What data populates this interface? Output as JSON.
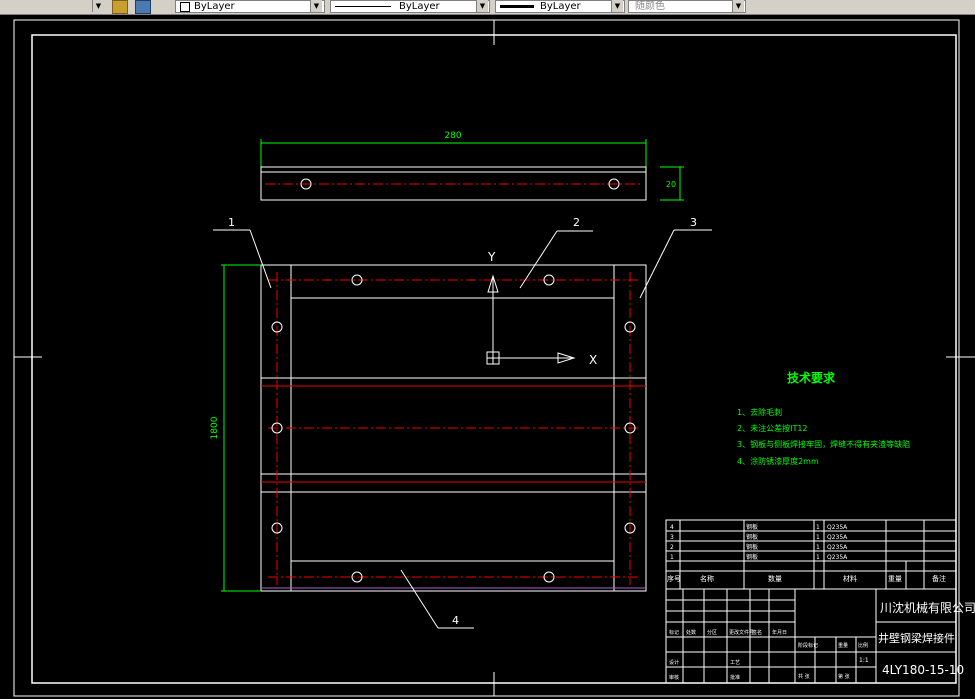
{
  "toolbar": {
    "layer_dropdown_arrow": "▼",
    "color_label": "ByLayer",
    "linetype_label": "ByLayer",
    "lineweight_label": "ByLayer",
    "plotstyle_label": "随颜色"
  },
  "drawing": {
    "top_dimension": "280",
    "side_dimension": "20",
    "left_dimension": "1800",
    "callouts": [
      "1",
      "2",
      "3",
      "4"
    ],
    "ucs_x_label": "X",
    "ucs_y_label": "Y"
  },
  "notes": {
    "title": "技术要求",
    "items": [
      "1、去除毛刺",
      "2、未注公差按IT12",
      "3、钢板与侧板焊接牢固，焊缝不得有夹渣等缺陷",
      "4、涂防锈漆厚度2mm"
    ]
  },
  "title_block": {
    "parts_list": [
      {
        "no": "4",
        "name": "钢板",
        "qty": "1",
        "material": "Q235A"
      },
      {
        "no": "3",
        "name": "钢板",
        "qty": "1",
        "material": "Q235A"
      },
      {
        "no": "2",
        "name": "钢板",
        "qty": "1",
        "material": "Q235A"
      },
      {
        "no": "1",
        "name": "钢板",
        "qty": "1",
        "material": "Q235A"
      }
    ],
    "header": {
      "no": "序号",
      "name": "名称",
      "qty": "数量",
      "material": "材料",
      "weight": "重量",
      "note": "备注"
    },
    "company": "川沈机械有限公司",
    "part_name": "井壁钢梁焊接件",
    "drawing_no": "4LY180-15-10",
    "scale": "1:1",
    "labels": [
      "标记",
      "处数",
      "分区",
      "更改文件号",
      "签名",
      "年月日",
      "设计",
      "审核",
      "工艺",
      "批准",
      "阶段标记",
      "重量",
      "比例",
      "共 张",
      "第 张"
    ]
  }
}
